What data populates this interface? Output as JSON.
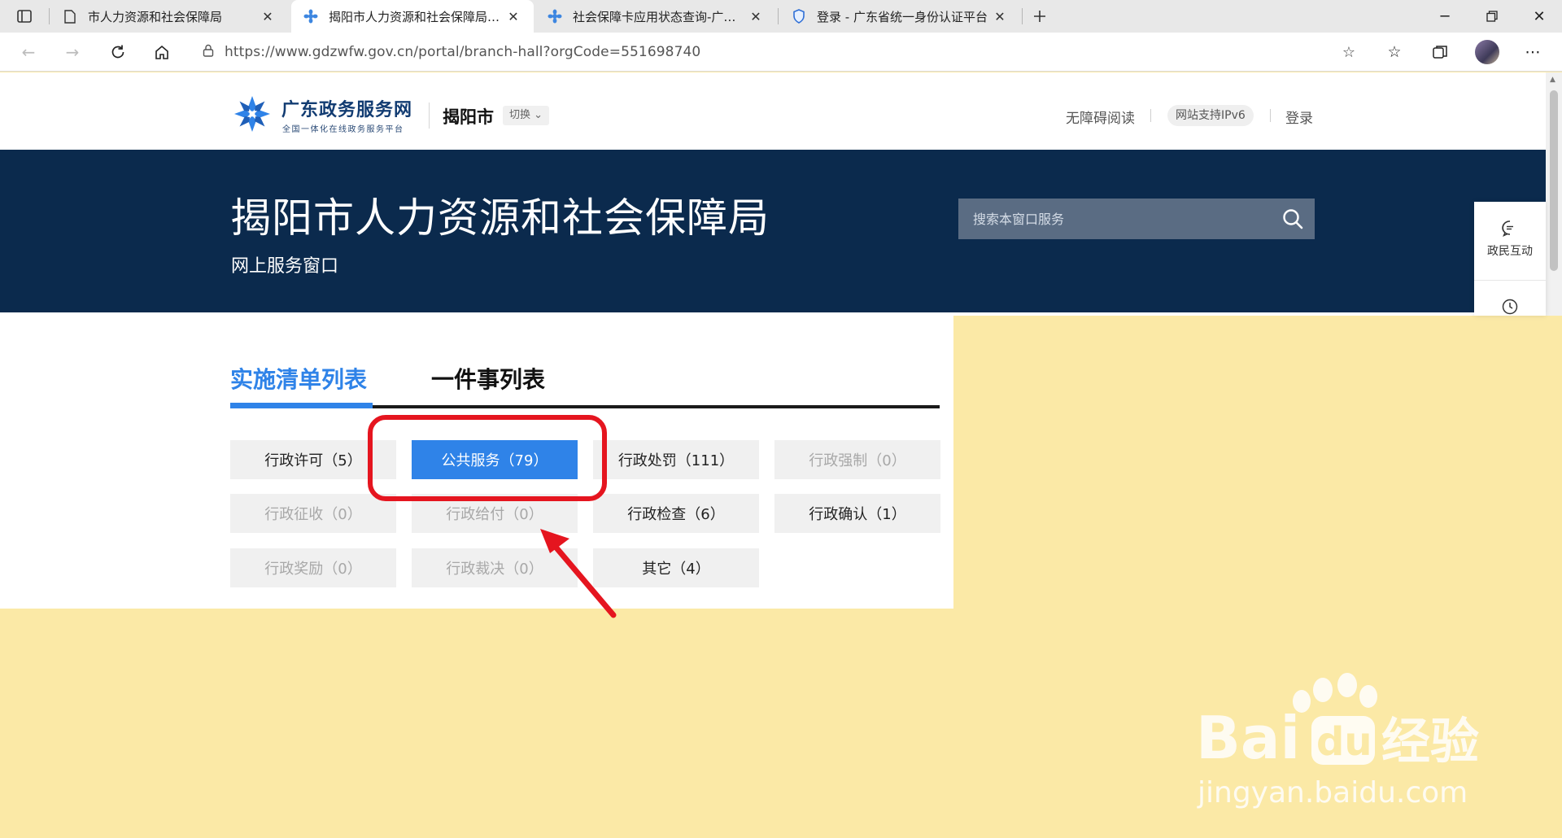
{
  "browser": {
    "tabs": [
      {
        "title": "市人力资源和社会保障局"
      },
      {
        "title": "揭阳市人力资源和社会保障局政务服务"
      },
      {
        "title": "社会保障卡应用状态查询-广东政务服务网"
      },
      {
        "title": "登录 - 广东省统一身份认证平台"
      }
    ],
    "url": "https://www.gdzwfw.gov.cn/portal/branch-hall?orgCode=551698740"
  },
  "header": {
    "logo_name": "广东政务服务网",
    "logo_sub": "全国一体化在线政务服务平台",
    "city": "揭阳市",
    "switch_label": "切换",
    "links": {
      "accessibility": "无障碍阅读",
      "ipv6": "网站支持IPv6",
      "login": "登录"
    }
  },
  "banner": {
    "title": "揭阳市人力资源和社会保障局",
    "subtitle": "网上服务窗口",
    "search_placeholder": "搜索本窗口服务"
  },
  "float_panel": {
    "interaction_label": "政民互动"
  },
  "content": {
    "tabs": [
      "实施清单列表",
      "一件事列表"
    ],
    "categories": [
      {
        "label": "行政许可（5）"
      },
      {
        "label": "公共服务（79）"
      },
      {
        "label": "行政处罚（111）"
      },
      {
        "label": "行政强制（0）"
      },
      {
        "label": "行政征收（0）"
      },
      {
        "label": "行政给付（0）"
      },
      {
        "label": "行政检查（6）"
      },
      {
        "label": "行政确认（1）"
      },
      {
        "label": "行政奖励（0）"
      },
      {
        "label": "行政裁决（0）"
      },
      {
        "label": "其它（4）"
      }
    ]
  },
  "colors": {
    "brand_blue": "#2f83e8",
    "banner_navy": "#0b2a4d",
    "highlight_red": "#e5151f",
    "background_yellow": "#fbe9a6"
  },
  "watermark": {
    "brand": "Baidu",
    "brand_cn": "经验",
    "domain": "jingyan.baidu.com"
  }
}
